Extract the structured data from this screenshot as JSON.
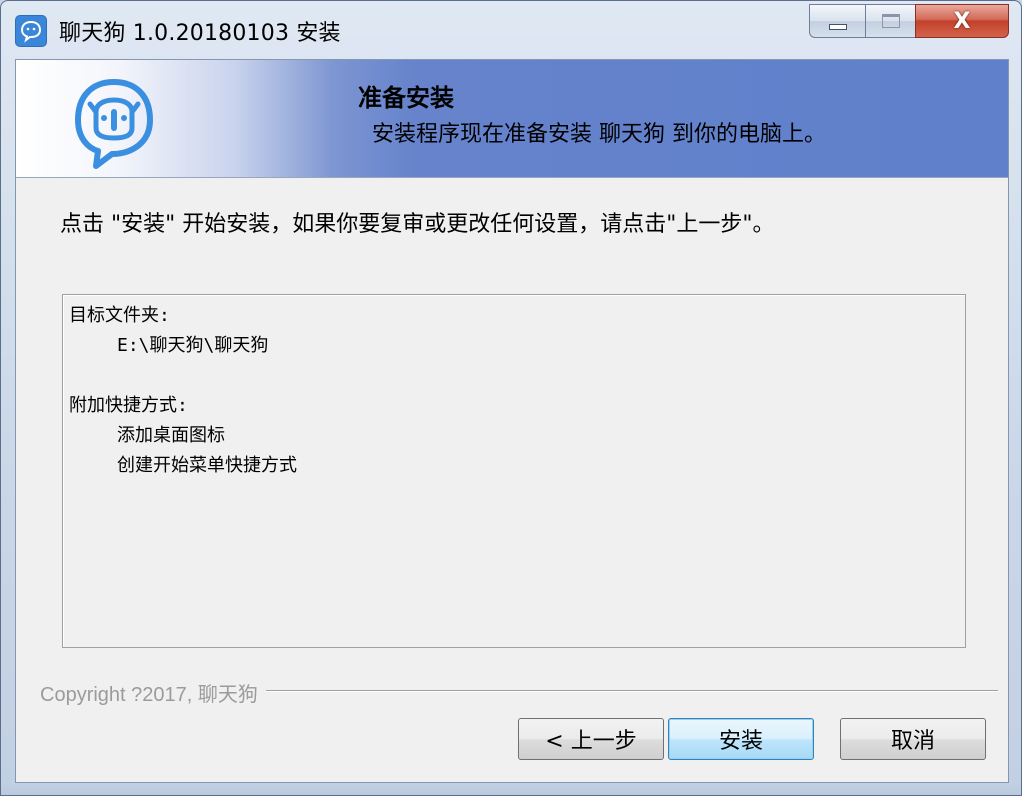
{
  "window": {
    "title": "聊天狗 1.0.20180103 安装",
    "minimize_icon": "minimize-icon",
    "maximize_icon": "maximize-icon",
    "close_glyph": "X"
  },
  "header": {
    "logo_icon": "chat-dog-logo-icon",
    "title": "准备安装",
    "subtitle": "安装程序现在准备安装 聊天狗 到你的电脑上。"
  },
  "main": {
    "instruction": "点击 \"安装\" 开始安装，如果你要复审或更改任何设置，请点击\"上一步\"。",
    "summary": {
      "dest_label": "目标文件夹:",
      "dest_path": "E:\\聊天狗\\聊天狗",
      "shortcuts_label": "附加快捷方式:",
      "shortcuts": [
        "添加桌面图标",
        "创建开始菜单快捷方式"
      ]
    }
  },
  "footer": {
    "copyright": "Copyright ?2017, 聊天狗",
    "back_label": "< 上一步",
    "install_label": "安装",
    "cancel_label": "取消"
  },
  "colors": {
    "header_blue": "#6080cb",
    "logo_blue": "#3b8fe0",
    "default_button_border": "#3c7fb1"
  }
}
